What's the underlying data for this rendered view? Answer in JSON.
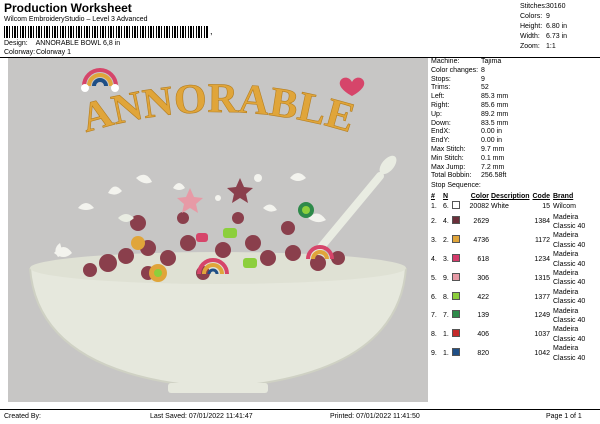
{
  "header": {
    "title": "Production Worksheet",
    "subtitle": "Wilcom EmbroideryStudio – Level 3 Advanced",
    "barcode_suffix": ","
  },
  "design_info": {
    "design_label": "Design:",
    "design_value": "ANNORABLE BOWL 6,8 in",
    "colorway_label": "Colorway:",
    "colorway_value": "Colorway 1"
  },
  "top_stats": [
    {
      "key": "Stitches:",
      "value": "30160"
    },
    {
      "key": "Colors:",
      "value": "9"
    },
    {
      "key": "Height:",
      "value": "6.80 in"
    },
    {
      "key": "Width:",
      "value": "6.73 in"
    },
    {
      "key": "Zoom:",
      "value": "1:1"
    }
  ],
  "artwork": {
    "text": "ANNORABLE"
  },
  "machine_info": [
    {
      "key": "Machine:",
      "value": "Tajima"
    },
    {
      "key": "Color changes:",
      "value": "8"
    },
    {
      "key": "Stops:",
      "value": "9"
    },
    {
      "key": "Trims:",
      "value": "52"
    },
    {
      "key": "Left:",
      "value": "85.3 mm"
    },
    {
      "key": "Right:",
      "value": "85.6 mm"
    },
    {
      "key": "Up:",
      "value": "89.2 mm"
    },
    {
      "key": "Down:",
      "value": "83.5 mm"
    },
    {
      "key": "EndX:",
      "value": "0.00 in"
    },
    {
      "key": "EndY:",
      "value": "0.00 in"
    },
    {
      "key": "Max Stitch:",
      "value": "9.7 mm"
    },
    {
      "key": "Min Stitch:",
      "value": "0.1 mm"
    },
    {
      "key": "Max Jump:",
      "value": "7.2 mm"
    },
    {
      "key": "Total Bobbin:",
      "value": "256.58ft"
    }
  ],
  "stop_sequence": {
    "label": "Stop Sequence:",
    "headers": [
      "#",
      "N",
      "Color",
      "Description",
      "Code",
      "Brand"
    ],
    "rows": [
      {
        "num": "1.",
        "n": "6.",
        "color": "#ffffff",
        "color_code": "20082",
        "desc": "White",
        "code": "15",
        "brand": "Wilcom"
      },
      {
        "num": "2.",
        "n": "4.",
        "color": "#6b2f3a",
        "color_code": "2629",
        "desc": "",
        "code": "1384",
        "brand": "Madeira Classic 40"
      },
      {
        "num": "3.",
        "n": "2.",
        "color": "#e0a53a",
        "color_code": "4736",
        "desc": "",
        "code": "1172",
        "brand": "Madeira Classic 40"
      },
      {
        "num": "4.",
        "n": "3.",
        "color": "#d43a6a",
        "color_code": "618",
        "desc": "",
        "code": "1234",
        "brand": "Madeira Classic 40"
      },
      {
        "num": "5.",
        "n": "9.",
        "color": "#e79aa6",
        "color_code": "306",
        "desc": "",
        "code": "1315",
        "brand": "Madeira Classic 40"
      },
      {
        "num": "6.",
        "n": "8.",
        "color": "#8ccf3c",
        "color_code": "422",
        "desc": "",
        "code": "1377",
        "brand": "Madeira Classic 40"
      },
      {
        "num": "7.",
        "n": "7.",
        "color": "#2e8a4a",
        "color_code": "139",
        "desc": "",
        "code": "1249",
        "brand": "Madeira Classic 40"
      },
      {
        "num": "8.",
        "n": "1.",
        "color": "#c42a2a",
        "color_code": "406",
        "desc": "",
        "code": "1037",
        "brand": "Madeira Classic 40"
      },
      {
        "num": "9.",
        "n": "1.",
        "color": "#1f4f86",
        "color_code": "820",
        "desc": "",
        "code": "1042",
        "brand": "Madeira Classic 40"
      }
    ]
  },
  "footer": {
    "created_by": "Created By:",
    "last_saved": "Last Saved: 07/01/2022 11:41:47",
    "printed": "Printed: 07/01/2022 11:41:50",
    "page": "Page 1 of 1"
  }
}
